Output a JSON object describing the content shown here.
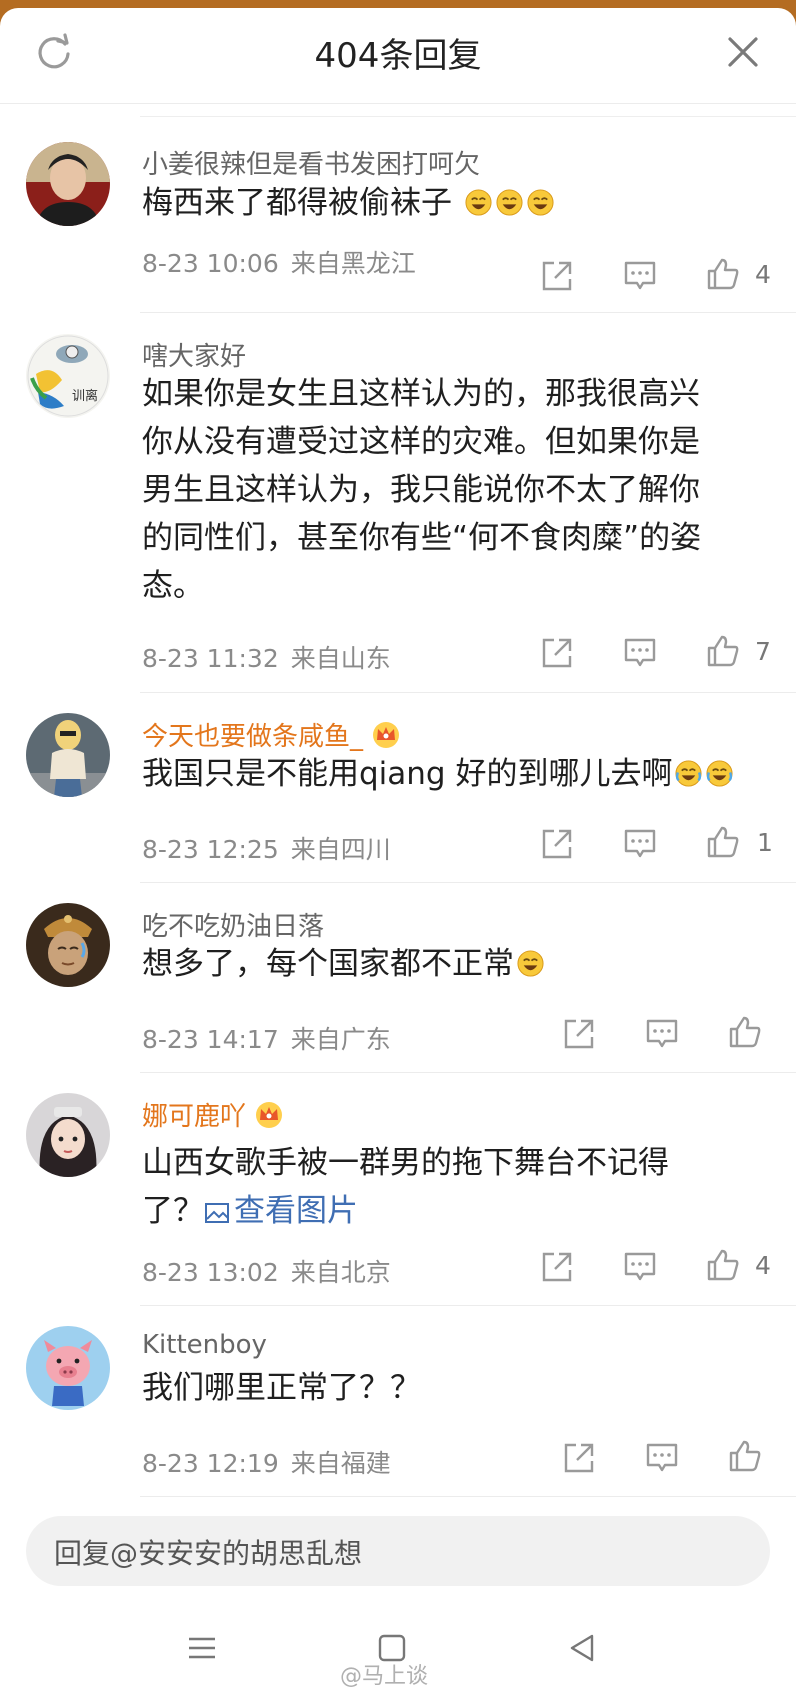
{
  "header": {
    "title": "404条回复"
  },
  "comments": [
    {
      "user": "小姜很辣但是看书发困打呵欠",
      "text_lines": [
        "梅西来了都得被偷袜子"
      ],
      "emoji_count": 3,
      "time": "8-23 10:06",
      "location": "来自黑龙江",
      "likes": "4",
      "vip": false
    },
    {
      "user": "嗐大家好",
      "text_lines": [
        "如果你是女生且这样认为的，那我很高兴",
        "你从没有遭受过这样的灾难。但如果你是",
        "男生且这样认为，我只能说你不太了解你",
        "的同性们，甚至你有些“何不食肉糜”的姿",
        "态。"
      ],
      "emoji_count": 0,
      "time": "8-23 11:32",
      "location": "来自山东",
      "likes": "7",
      "vip": false
    },
    {
      "user": "今天也要做条咸鱼_",
      "text_lines": [
        "我国只是不能用qiang 好的到哪儿去啊"
      ],
      "emoji_count": 2,
      "time": "8-23 12:25",
      "location": "来自四川",
      "likes": "1",
      "vip": true
    },
    {
      "user": "吃不吃奶油日落",
      "text_lines": [
        "想多了，每个国家都不正常"
      ],
      "emoji_count": 1,
      "time": "8-23 14:17",
      "location": "来自广东",
      "likes": "",
      "vip": false
    },
    {
      "user": "娜可鹿吖",
      "text_lines": [
        "山西女歌手被一群男的拖下舞台不记得",
        "了？"
      ],
      "view_pic": "查看图片",
      "emoji_count": 0,
      "time": "8-23 13:02",
      "location": "来自北京",
      "likes": "4",
      "vip": true
    },
    {
      "user": "Kittenboy",
      "text_lines": [
        "我们哪里正常了？？"
      ],
      "emoji_count": 0,
      "time": "8-23 12:19",
      "location": "来自福建",
      "likes": "",
      "vip": false
    }
  ],
  "reply_box": {
    "placeholder": "回复@安安安的胡思乱想"
  },
  "watermark": "@马上谈",
  "colors": {
    "vip_name": "#e3761c",
    "link": "#3f6eb3",
    "meta": "#8a8a8a",
    "top_bar": "#b46c22"
  },
  "icons": [
    "refresh-icon",
    "close-icon",
    "share-icon",
    "comment-icon",
    "like-icon",
    "crown-icon",
    "image-icon",
    "menu-icon",
    "home-icon",
    "back-icon"
  ]
}
